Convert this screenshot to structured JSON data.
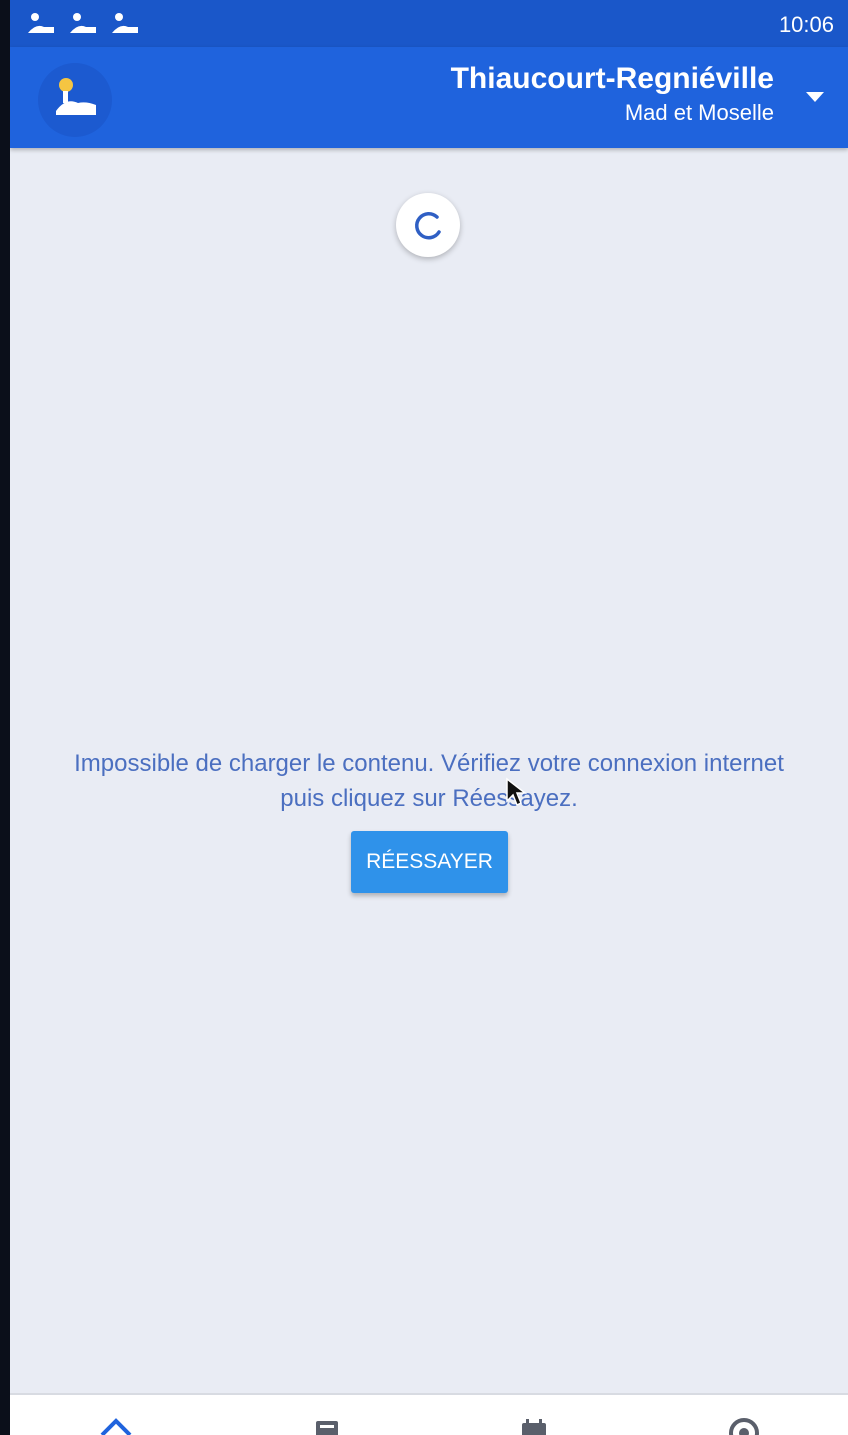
{
  "status_bar": {
    "time": "10:06",
    "icons": [
      "notification-icon",
      "notification-icon",
      "notification-icon"
    ]
  },
  "header": {
    "logo_icon": "app-logo-icon",
    "town": "Thiaucourt-Regniéville",
    "region": "Mad et Moselle",
    "dropdown_icon": "caret-down-icon"
  },
  "main": {
    "loading_icon": "spinner-icon",
    "error_message": "Impossible de charger le contenu. Vérifiez votre connexion internet puis cliquez sur Réessayez.",
    "retry_label": "RÉESSAYER"
  },
  "bottom_nav": {
    "items": [
      {
        "icon": "home-icon"
      },
      {
        "icon": "news-icon"
      },
      {
        "icon": "calendar-icon"
      },
      {
        "icon": "info-icon"
      }
    ]
  },
  "colors": {
    "primary": "#1f63dd",
    "status_bar": "#1a57c9",
    "background": "#e9ecf4",
    "button": "#2f92ea",
    "message_text": "#4b6fc0"
  }
}
